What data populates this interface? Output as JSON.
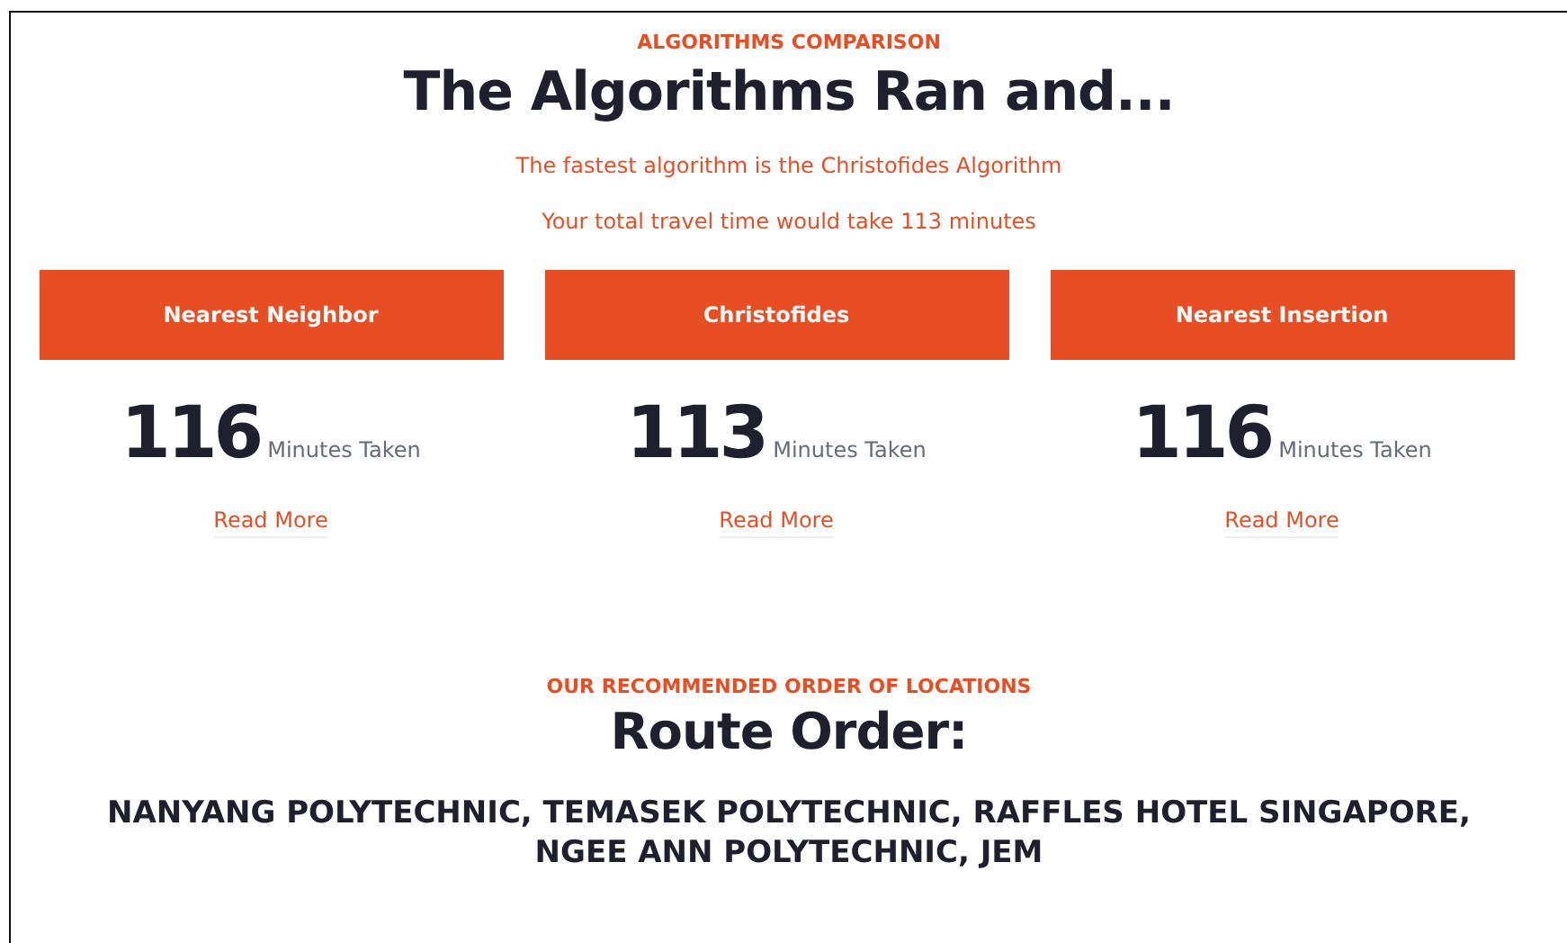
{
  "comparison": {
    "eyebrow": "ALGORITHMS COMPARISON",
    "title": "The Algorithms Ran and...",
    "lines": [
      "The fastest algorithm is the Christofides Algorithm",
      "Your total travel time would take 113 minutes"
    ]
  },
  "algorithms": [
    {
      "name": "Nearest Neighbor",
      "minutes": "116",
      "unit": "Minutes Taken",
      "link": "Read More"
    },
    {
      "name": "Christofides",
      "minutes": "113",
      "unit": "Minutes Taken",
      "link": "Read More"
    },
    {
      "name": "Nearest Insertion",
      "minutes": "116",
      "unit": "Minutes Taken",
      "link": "Read More"
    }
  ],
  "route": {
    "eyebrow": "OUR RECOMMENDED ORDER OF LOCATIONS",
    "title": "Route Order:",
    "order": "NANYANG POLYTECHNIC, TEMASEK POLYTECHNIC, RAFFLES HOTEL SINGAPORE, NGEE ANN POLYTECHNIC, JEM"
  }
}
